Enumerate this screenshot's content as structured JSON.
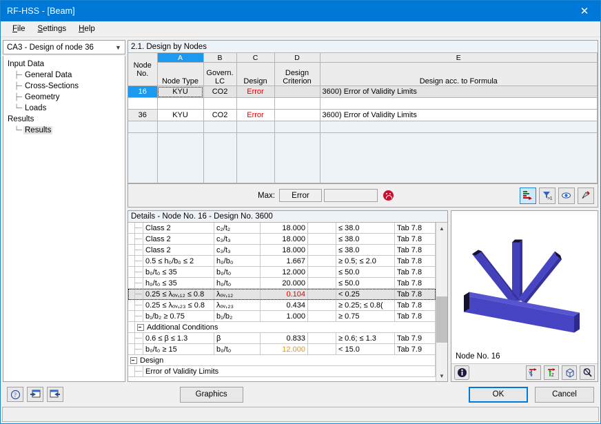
{
  "window": {
    "title": "RF-HSS - [Beam]",
    "close_icon": "close-icon"
  },
  "menu": {
    "items": [
      {
        "label": "File",
        "accel": "F"
      },
      {
        "label": "Settings",
        "accel": "S"
      },
      {
        "label": "Help",
        "accel": "H"
      }
    ]
  },
  "sidebar": {
    "combo": {
      "value": "CA3 - Design of node 36",
      "icon": "chevron-down-icon"
    },
    "tree": [
      {
        "label": "Input Data",
        "level": 0,
        "selected": false
      },
      {
        "label": "General Data",
        "level": 1,
        "selected": false
      },
      {
        "label": "Cross-Sections",
        "level": 1,
        "selected": false
      },
      {
        "label": "Geometry",
        "level": 1,
        "selected": false
      },
      {
        "label": "Loads",
        "level": 1,
        "selected": false
      },
      {
        "label": "Results",
        "level": 0,
        "selected": false
      },
      {
        "label": "Results",
        "level": 1,
        "selected": true
      }
    ]
  },
  "table": {
    "title": "2.1. Design by Nodes",
    "column_letters": [
      "A",
      "B",
      "C",
      "D",
      "E"
    ],
    "active_column": "A",
    "corner_header": "Node\nNo.",
    "corner_header_l1": "Node",
    "corner_header_l2": "No.",
    "headers": [
      {
        "l1": "",
        "l2": "Node Type"
      },
      {
        "l1": "Govern.",
        "l2": "LC"
      },
      {
        "l1": "",
        "l2": "Design"
      },
      {
        "l1": "Design",
        "l2": "Criterion"
      },
      {
        "l1": "",
        "l2": "Design acc. to Formula"
      }
    ],
    "rows": [
      {
        "node": "16",
        "node_type": "KYU",
        "lc": "CO2",
        "design": "Error",
        "criterion": "",
        "formula": "3600) Error of Validity Limits",
        "selected": true
      },
      {
        "node": "",
        "node_type": "",
        "lc": "",
        "design": "",
        "criterion": "",
        "formula": "",
        "selected": false,
        "empty": true
      },
      {
        "node": "36",
        "node_type": "KYU",
        "lc": "CO2",
        "design": "Error",
        "criterion": "",
        "formula": "3600) Error of Validity Limits",
        "selected": false
      }
    ],
    "max": {
      "label": "Max:",
      "value": "Error",
      "second_value": "",
      "status_icon": "sad-face-icon"
    },
    "toolbar": [
      {
        "name": "result-table-icon",
        "active": true
      },
      {
        "name": "filter-icon",
        "active": false
      },
      {
        "name": "visibility-eye-icon",
        "active": false
      },
      {
        "name": "pin-selection-icon",
        "active": false
      }
    ]
  },
  "details": {
    "title": "Details - Node No. 16 - Design No. 3600",
    "rows": [
      {
        "kind": "item",
        "name": "Class 2",
        "symbol": "c₂/t₂",
        "value": "18.000",
        "unit": "",
        "limit": "≤ 38.0",
        "ref": "Tab 7.8",
        "value_color": "",
        "selected": false
      },
      {
        "kind": "item",
        "name": "Class 2",
        "symbol": "c₃/t₃",
        "value": "18.000",
        "unit": "",
        "limit": "≤ 38.0",
        "ref": "Tab 7.8",
        "value_color": "",
        "selected": false
      },
      {
        "kind": "item",
        "name": "Class 2",
        "symbol": "c₃/t₃",
        "value": "18.000",
        "unit": "",
        "limit": "≤ 38.0",
        "ref": "Tab 7.8",
        "value_color": "",
        "selected": false
      },
      {
        "kind": "item",
        "name": "0.5 ≤ h₀/b₀ ≤ 2",
        "symbol": "h₀/b₀",
        "value": "1.667",
        "unit": "",
        "limit": "≥ 0.5; ≤ 2.0",
        "ref": "Tab 7.8",
        "value_color": "",
        "selected": false
      },
      {
        "kind": "item",
        "name": "b₀/t₀ ≤ 35",
        "symbol": "b₀/t₀",
        "value": "12.000",
        "unit": "",
        "limit": "≤ 50.0",
        "ref": "Tab 7.8",
        "value_color": "",
        "selected": false
      },
      {
        "kind": "item",
        "name": "h₀/t₀ ≤ 35",
        "symbol": "h₀/t₀",
        "value": "20.000",
        "unit": "",
        "limit": "≤ 50.0",
        "ref": "Tab 7.8",
        "value_color": "",
        "selected": false
      },
      {
        "kind": "item",
        "name": "0.25 ≤ λₒᵥ,₁₂ ≤ 0.8",
        "symbol": "λₒᵥ,₁₂",
        "value": "0.104",
        "unit": "",
        "limit": "< 0.25",
        "ref": "Tab 7.8",
        "value_color": "red",
        "selected": true
      },
      {
        "kind": "item",
        "name": "0.25 ≤ λₒᵥ,₂₃ ≤ 0.8",
        "symbol": "λₒᵥ,₂₃",
        "value": "0.434",
        "unit": "",
        "limit": "≥ 0.25; ≤ 0.8(",
        "ref": "Tab 7.8",
        "value_color": "",
        "selected": false
      },
      {
        "kind": "item",
        "name": "b₁/b₂ ≥ 0.75",
        "symbol": "b₁/b₂",
        "value": "1.000",
        "unit": "",
        "limit": "≥ 0.75",
        "ref": "Tab 7.8",
        "value_color": "",
        "selected": false
      },
      {
        "kind": "group",
        "name": "Additional Conditions"
      },
      {
        "kind": "item",
        "name": "0.6 ≤ β ≤ 1.3",
        "symbol": "β",
        "value": "0.833",
        "unit": "",
        "limit": "≥ 0.6; ≤ 1.3",
        "ref": "Tab 7.9",
        "value_color": "",
        "selected": false
      },
      {
        "kind": "item",
        "name": "b₀/t₀ ≥ 15",
        "symbol": "b₀/t₀",
        "value": "12.000",
        "unit": "",
        "limit": "< 15.0",
        "ref": "Tab 7.9",
        "value_color": "orange",
        "selected": false
      },
      {
        "kind": "group",
        "name": "Design"
      },
      {
        "kind": "leaf",
        "name": "Error of Validity Limits"
      }
    ],
    "scroll": {
      "up_icon": "chevron-up-icon",
      "down_icon": "chevron-down-icon"
    }
  },
  "graphics": {
    "caption": "Node No. 16",
    "model_color": "#3b39b0",
    "buttons": [
      {
        "name": "info-icon"
      },
      {
        "name": "view-y-axis-icon"
      },
      {
        "name": "view-z-axis-icon"
      },
      {
        "name": "isometric-view-icon"
      },
      {
        "name": "zoom-reset-icon"
      }
    ]
  },
  "footer": {
    "help_icon": "help-question-icon",
    "prev_icon": "previous-page-icon",
    "next_icon": "next-page-icon",
    "graphics_label": "Graphics",
    "graphics_accel": "G",
    "ok_label": "OK",
    "cancel_label": "Cancel"
  },
  "statusbar": {
    "text": ""
  }
}
